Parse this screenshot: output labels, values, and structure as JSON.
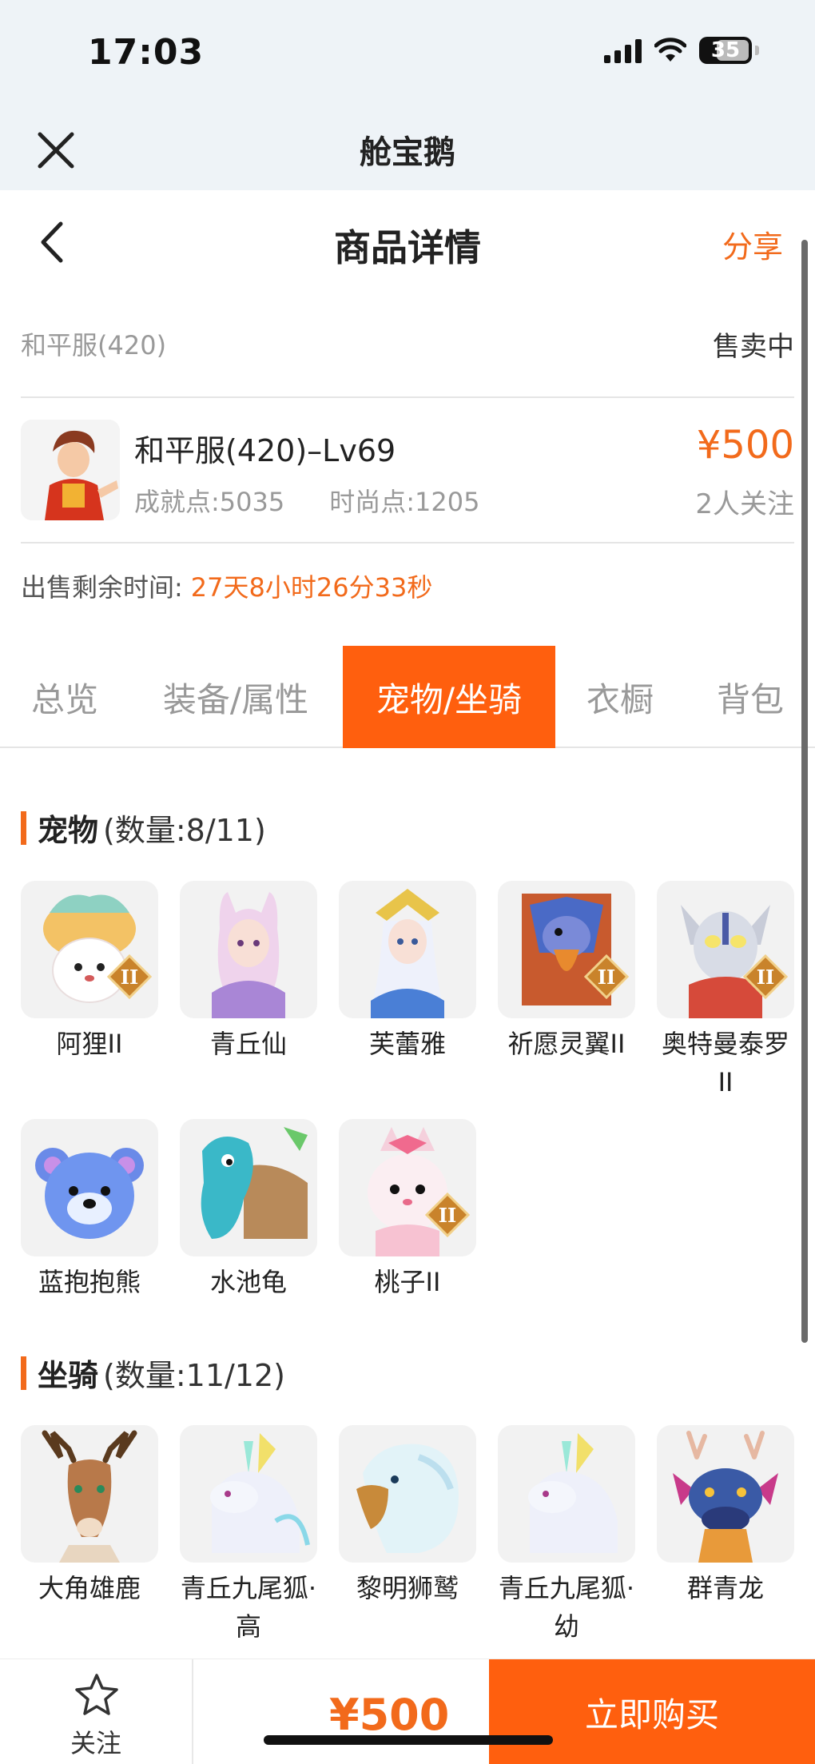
{
  "status_bar": {
    "time": "17:03",
    "battery": "35"
  },
  "app_bar": {
    "title": "舱宝鹅"
  },
  "header": {
    "title": "商品详情",
    "share": "分享"
  },
  "server": {
    "name": "和平服(420)",
    "status": "售卖中"
  },
  "product": {
    "name": "和平服(420)–Lv69",
    "achievement": "成就点:5035",
    "fashion": "时尚点:1205",
    "price": "¥500",
    "followers": "2人关注"
  },
  "remaining": {
    "label": "出售剩余时间:",
    "time": "27天8小时26分33秒"
  },
  "tabs": [
    "总览",
    "装备/属性",
    "宠物/坐骑",
    "衣橱",
    "背包"
  ],
  "active_tab": "宠物/坐骑",
  "pets_section": {
    "title": "宠物",
    "count": "(数量:8/11)"
  },
  "pets": [
    "阿狸II",
    "青丘仙",
    "芙蕾雅",
    "祈愿灵翼II",
    "奥特曼泰罗II",
    "蓝抱抱熊",
    "水池龟",
    "桃子II"
  ],
  "mounts_section": {
    "title": "坐骑",
    "count": "(数量:11/12)"
  },
  "mounts": [
    "大角雄鹿",
    "青丘九尾狐·高",
    "黎明狮鹫",
    "青丘九尾狐·幼",
    "群青龙"
  ],
  "bottom": {
    "follow": "关注",
    "price": "¥500",
    "buy": "立即购买"
  },
  "colors": {
    "accent": "#ff5f0e",
    "price": "#f26a1b"
  }
}
